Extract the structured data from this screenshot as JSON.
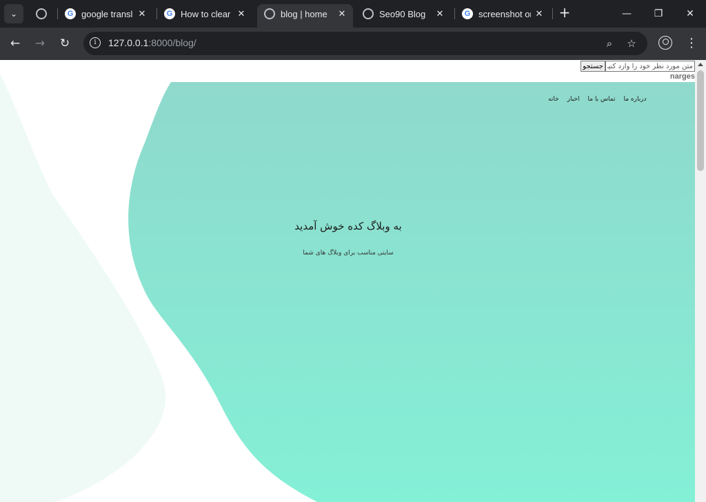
{
  "browser": {
    "tabs": [
      {
        "label": "",
        "icon": "globe-icon"
      },
      {
        "label": "google transl",
        "icon": "google-icon"
      },
      {
        "label": "How to clear t",
        "icon": "google-icon"
      },
      {
        "label": "blog | home",
        "icon": "globe-icon",
        "active": true
      },
      {
        "label": "Seo90 Blog",
        "icon": "globe-icon"
      },
      {
        "label": "screenshot or",
        "icon": "google-icon"
      }
    ],
    "url_host": "127.0.0.1",
    "url_rest": ":8000/blog/"
  },
  "page": {
    "search_placeholder": "متن مورد نظر خود را وارد کنید...",
    "search_button": "جستجو",
    "username": "narges",
    "nav": [
      "خانه",
      "اخبار",
      "تماس با ما",
      "درباره ما"
    ],
    "hero_title": "به وبلاگ کده خوش آمدید",
    "hero_subtitle": "سایتی مناسب برای وبلاگ های شما"
  },
  "colors": {
    "blob_top": "#8fd9cc",
    "blob_bottom": "#84f0d6",
    "side_shape": "#effaf7",
    "chrome_dark": "#202124",
    "chrome_mid": "#35363a"
  }
}
